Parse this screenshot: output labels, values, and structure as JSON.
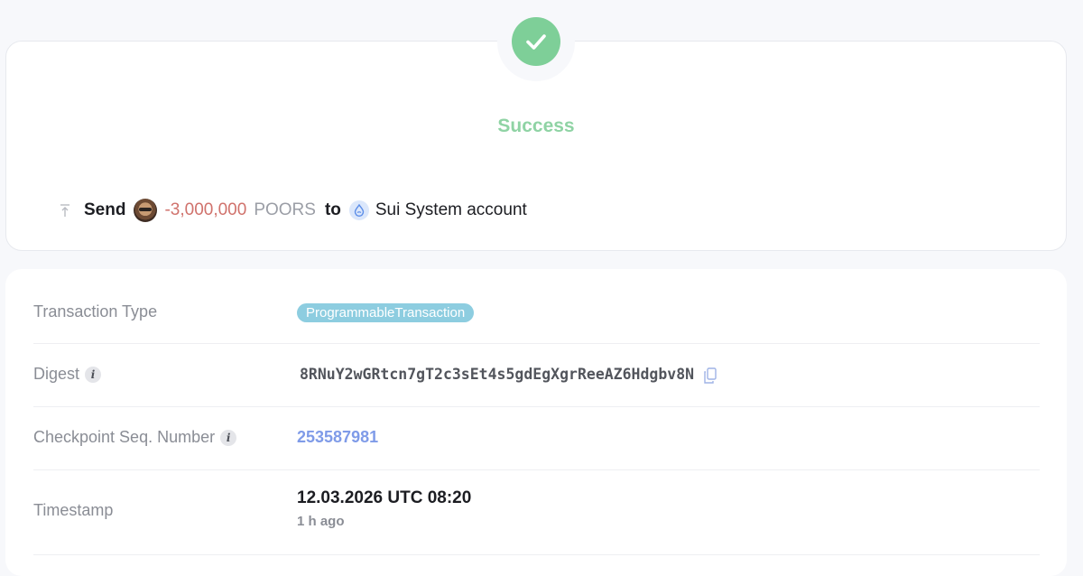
{
  "status": {
    "icon": "checkmark-icon",
    "label": "Success",
    "color": "#7ecf98"
  },
  "action": {
    "icon": "send-icon",
    "verb": "Send",
    "amount": "-3,000,000",
    "token": "POORS",
    "preposition": "to",
    "recipient_icon": "sui-logo-icon",
    "recipient": "Sui System account"
  },
  "details": {
    "transaction_type": {
      "label": "Transaction Type",
      "value": "ProgrammableTransaction"
    },
    "digest": {
      "label": "Digest",
      "value": "8RNuY2wGRtcn7gT2c3sEt4s5gdEgXgrReeAZ6Hdgbv8N",
      "copy_icon": "copy-icon"
    },
    "checkpoint": {
      "label": "Checkpoint Seq. Number",
      "value": "253587981"
    },
    "timestamp": {
      "label": "Timestamp",
      "value": "12.03.2026 UTC 08:20",
      "relative": "1 h ago"
    }
  }
}
